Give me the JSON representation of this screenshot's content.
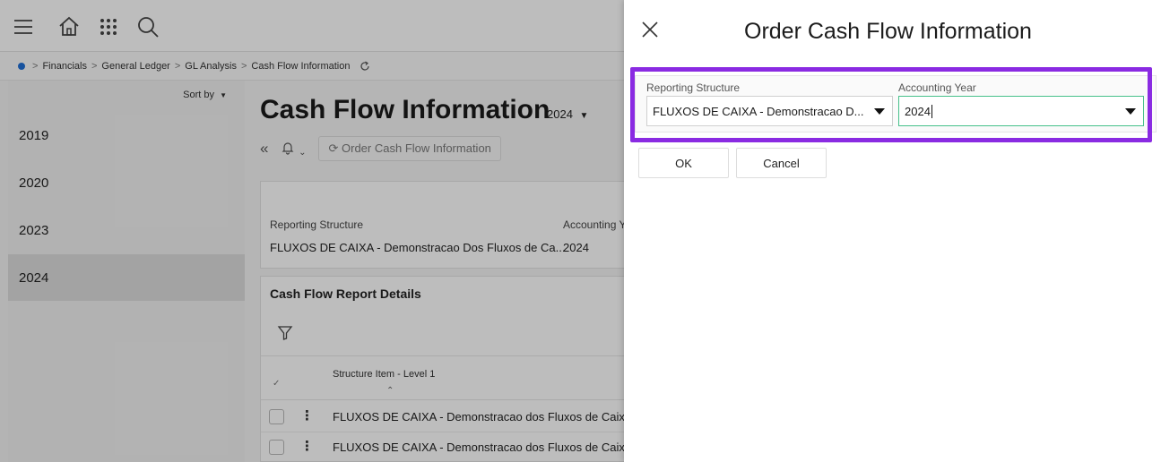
{
  "breadcrumb": {
    "items": [
      "Financials",
      "General Ledger",
      "GL Analysis",
      "Cash Flow Information"
    ],
    "separator": ">"
  },
  "years_panel": {
    "sort_label": "Sort by",
    "years": [
      "2019",
      "2020",
      "2023",
      "2024"
    ],
    "selected": "2024"
  },
  "page": {
    "title": "Cash Flow Information",
    "year": "2024",
    "order_button_label": "Order Cash Flow Information"
  },
  "info": {
    "reporting_structure_label": "Reporting Structure",
    "reporting_structure_value": "FLUXOS DE CAIXA - Demonstracao Dos Fluxos de Ca...",
    "accounting_year_label": "Accounting Y",
    "accounting_year_value": "2024"
  },
  "details": {
    "title": "Cash Flow Report Details",
    "column_header": "Structure Item - Level 1",
    "rows": [
      "FLUXOS DE CAIXA - Demonstracao dos Fluxos de Caixa",
      "FLUXOS DE CAIXA - Demonstracao dos Fluxos de Caixa"
    ]
  },
  "dialog": {
    "title": "Order Cash Flow Information",
    "reporting_structure_label": "Reporting Structure",
    "reporting_structure_value": "FLUXOS DE CAIXA - Demonstracao D...",
    "accounting_year_label": "Accounting Year",
    "accounting_year_value": "2024",
    "ok_label": "OK",
    "cancel_label": "Cancel"
  },
  "colors": {
    "highlight": "#8a2be2",
    "focus_border": "#46c08a",
    "breadcrumb_dot": "#1f6fd6"
  },
  "icons": [
    "menu-icon",
    "home-icon",
    "apps-grid-icon",
    "search-icon",
    "refresh-icon",
    "collapse-icon",
    "bell-icon",
    "filter-icon",
    "close-icon"
  ]
}
